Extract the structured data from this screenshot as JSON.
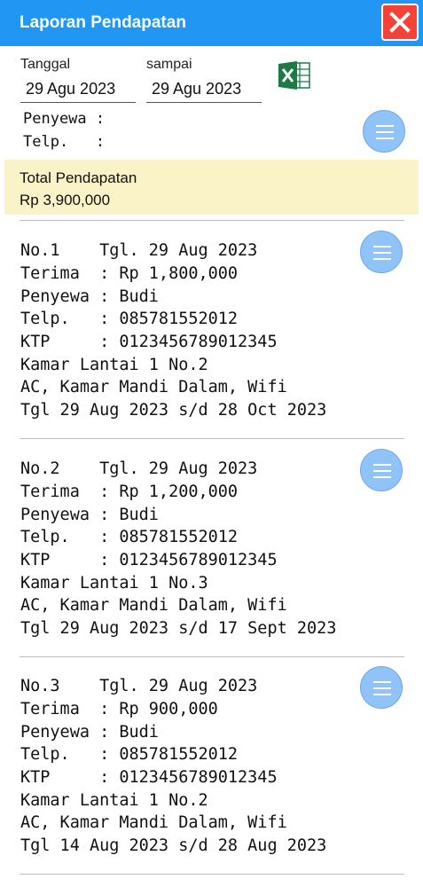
{
  "header": {
    "title": "Laporan Pendapatan"
  },
  "filter": {
    "from_label": "Tanggal",
    "from_value": "29 Agu 2023",
    "to_label": "sampai",
    "to_value": "29 Agu 2023"
  },
  "tenant": {
    "penyewa_line": "Penyewa :",
    "telp_line": "Telp.   :"
  },
  "total": {
    "label": "Total Pendapatan",
    "value": "Rp 3,900,000"
  },
  "records": [
    {
      "l1": "No.1    Tgl. 29 Aug 2023",
      "l2": "Terima  : Rp 1,800,000",
      "l3": "Penyewa : Budi",
      "l4": "Telp.   : 085781552012",
      "l5": "KTP     : 0123456789012345",
      "l6": "Kamar Lantai 1 No.2",
      "l7": "AC, Kamar Mandi Dalam, Wifi",
      "l8": "Tgl 29 Aug 2023 s/d 28 Oct 2023"
    },
    {
      "l1": "No.2    Tgl. 29 Aug 2023",
      "l2": "Terima  : Rp 1,200,000",
      "l3": "Penyewa : Budi",
      "l4": "Telp.   : 085781552012",
      "l5": "KTP     : 0123456789012345",
      "l6": "Kamar Lantai 1 No.3",
      "l7": "AC, Kamar Mandi Dalam, Wifi",
      "l8": "Tgl 29 Aug 2023 s/d 17 Sept 2023"
    },
    {
      "l1": "No.3    Tgl. 29 Aug 2023",
      "l2": "Terima  : Rp 900,000",
      "l3": "Penyewa : Budi",
      "l4": "Telp.   : 085781552012",
      "l5": "KTP     : 0123456789012345",
      "l6": "Kamar Lantai 1 No.2",
      "l7": "AC, Kamar Mandi Dalam, Wifi",
      "l8": "Tgl 14 Aug 2023 s/d 28 Aug 2023"
    }
  ],
  "icons": {
    "close": "close-icon",
    "excel": "excel-icon",
    "menu": "menu-icon"
  },
  "colors": {
    "appbar": "#2196F3",
    "close": "#F44336",
    "total_bg": "#FAF3C8",
    "menu_button": "#90C4F8",
    "excel": "#1D7A45"
  }
}
